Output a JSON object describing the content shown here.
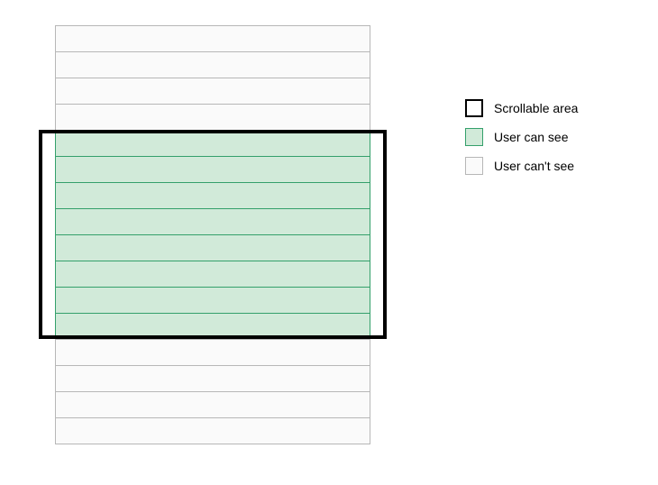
{
  "legend": {
    "scrollable": "Scrollable area",
    "visible": "User can see",
    "invisible": "User can't see"
  },
  "rows": {
    "above_count": 4,
    "visible_count": 8,
    "below_count": 4
  },
  "colors": {
    "visible_fill": "#d1ead9",
    "visible_border": "#34a06b",
    "invisible_fill": "#fafafa",
    "invisible_border": "#b7b7b7",
    "scrollable_border": "#000000"
  }
}
